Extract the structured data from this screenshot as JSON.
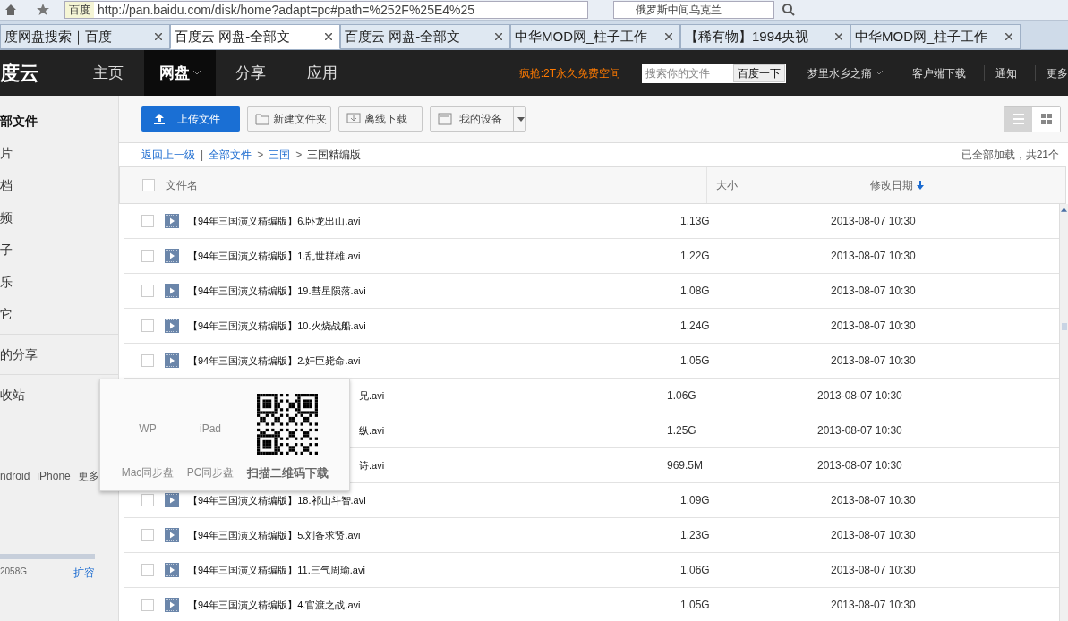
{
  "browser": {
    "engine": "百度",
    "address": "http://pan.baidu.com/disk/home?adapt=pc#path=%252F%25E4%25",
    "search_value": "俄罗斯中间乌克兰",
    "tabs": [
      {
        "title": "度网盘搜索｜百度",
        "selected": false
      },
      {
        "title": "百度云 网盘-全部文",
        "selected": true
      },
      {
        "title": "百度云 网盘-全部文",
        "selected": false
      },
      {
        "title": "中华MOD网_柱子工作",
        "selected": false
      },
      {
        "title": "【稀有物】1994央视",
        "selected": false
      },
      {
        "title": "中华MOD网_柱子工作",
        "selected": false
      }
    ]
  },
  "nav": {
    "logo": "度云",
    "items": [
      {
        "label": "主页",
        "selected": false
      },
      {
        "label": "网盘",
        "selected": true
      },
      {
        "label": "分享",
        "selected": false
      },
      {
        "label": "应用",
        "selected": false
      }
    ],
    "promo": "疯抢:2T永久免费空间",
    "search_placeholder": "搜索你的文件",
    "search_button": "百度一下",
    "user": "梦里水乡之痛",
    "links": [
      "客户端下载",
      "通知",
      "更多"
    ]
  },
  "sidebar": {
    "items": [
      {
        "label": "部文件",
        "selected": true
      },
      {
        "label": "片",
        "selected": false
      },
      {
        "label": "档",
        "selected": false
      },
      {
        "label": "频",
        "selected": false
      },
      {
        "label": "子",
        "selected": false
      },
      {
        "label": "乐",
        "selected": false
      },
      {
        "label": "它",
        "selected": false
      }
    ],
    "share": "的分享",
    "recycle": "收站",
    "apps": [
      "ndroid",
      "iPhone",
      "更多"
    ],
    "quota": {
      "text": "2058G",
      "expand": "扩容"
    }
  },
  "toolbar": {
    "upload": "上传文件",
    "buttons": [
      "新建文件夹",
      "离线下载"
    ],
    "devices": "我的设备",
    "view_list_selected": true
  },
  "breadcrumb": {
    "items": [
      {
        "kind": "link",
        "text": "返回上一级"
      },
      {
        "kind": "sep",
        "text": "|"
      },
      {
        "kind": "link",
        "text": "全部文件"
      },
      {
        "kind": "sep",
        "text": ">"
      },
      {
        "kind": "link",
        "text": "三国"
      },
      {
        "kind": "sep",
        "text": ">"
      },
      {
        "kind": "current",
        "text": "三国精编版"
      }
    ],
    "status": "已全部加载，共21个"
  },
  "table": {
    "columns": [
      "文件名",
      "大小",
      "修改日期"
    ],
    "all_checked": false,
    "rows": [
      {
        "kind": "full",
        "checked": false,
        "name": "【94年三国演义精编版】6.卧龙出山.avi",
        "size": "1.13G",
        "date": "2013-08-07 10:30"
      },
      {
        "kind": "full",
        "checked": false,
        "name": "【94年三国演义精编版】1.乱世群雄.avi",
        "size": "1.22G",
        "date": "2013-08-07 10:30"
      },
      {
        "kind": "full",
        "checked": false,
        "name": "【94年三国演义精编版】19.彗星陨落.avi",
        "size": "1.08G",
        "date": "2013-08-07 10:30"
      },
      {
        "kind": "full",
        "checked": false,
        "name": "【94年三国演义精编版】10.火烧战船.avi",
        "size": "1.24G",
        "date": "2013-08-07 10:30"
      },
      {
        "kind": "full",
        "checked": false,
        "name": "【94年三国演义精编版】2.奸臣毙命.avi",
        "size": "1.05G",
        "date": "2013-08-07 10:30"
      },
      {
        "kind": "covered",
        "name": "兄.avi",
        "size": "1.06G",
        "date": "2013-08-07 10:30"
      },
      {
        "kind": "covered",
        "name": "纵.avi",
        "size": "1.25G",
        "date": "2013-08-07 10:30"
      },
      {
        "kind": "covered",
        "name": "诗.avi",
        "size": "969.5M",
        "date": "2013-08-07 10:30"
      },
      {
        "kind": "full",
        "checked": false,
        "name": "【94年三国演义精编版】18.祁山斗智.avi",
        "size": "1.09G",
        "date": "2013-08-07 10:30"
      },
      {
        "kind": "full",
        "checked": false,
        "name": "【94年三国演义精编版】5.刘备求贤.avi",
        "size": "1.23G",
        "date": "2013-08-07 10:30"
      },
      {
        "kind": "full",
        "checked": false,
        "name": "【94年三国演义精编版】11.三气周瑜.avi",
        "size": "1.06G",
        "date": "2013-08-07 10:30"
      },
      {
        "kind": "full",
        "checked": false,
        "name": "【94年三国演义精编版】4.官渡之战.avi",
        "size": "1.05G",
        "date": "2013-08-07 10:30"
      }
    ]
  },
  "popup": {
    "top": [
      "WP",
      "iPad"
    ],
    "bottom": [
      "Mac同步盘",
      "PC同步盘"
    ],
    "qr_caption": "扫描二维码下载"
  }
}
